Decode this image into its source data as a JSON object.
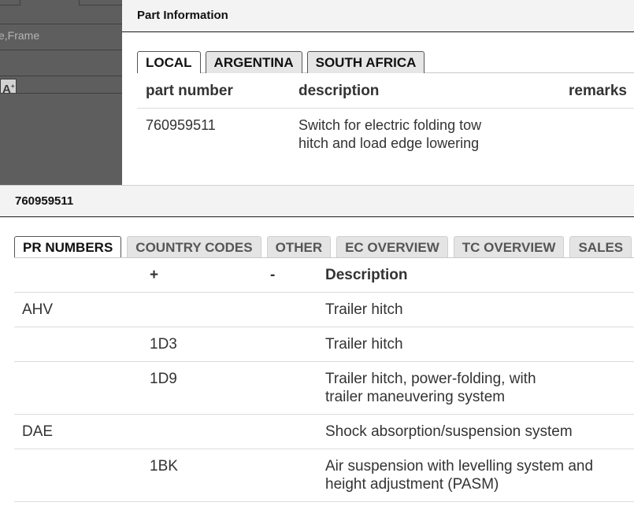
{
  "background": {
    "frame_text": "e,Frame",
    "font_icon_label": "A"
  },
  "part_info": {
    "title": "Part Information",
    "tabs": [
      {
        "label": "LOCAL",
        "active": true
      },
      {
        "label": "ARGENTINA",
        "active": false
      },
      {
        "label": "SOUTH AFRICA",
        "active": false
      }
    ],
    "columns": {
      "part_number": "part number",
      "description": "description",
      "remarks": "remarks"
    },
    "row": {
      "part_number": "760959511",
      "description": "Switch for electric folding tow hitch and load edge lowering",
      "remarks": ""
    }
  },
  "detail": {
    "title": "760959511",
    "tabs": [
      {
        "label": "PR NUMBERS",
        "active": true
      },
      {
        "label": "COUNTRY CODES",
        "active": false
      },
      {
        "label": "OTHER",
        "active": false
      },
      {
        "label": "EC OVERVIEW",
        "active": false
      },
      {
        "label": "TC OVERVIEW",
        "active": false
      },
      {
        "label": "SALES",
        "active": false
      }
    ],
    "columns": {
      "group": "",
      "plus": "+",
      "minus": "-",
      "description": "Description"
    },
    "rows": [
      {
        "group": "AHV",
        "plus": "",
        "minus": "",
        "description": "Trailer hitch"
      },
      {
        "group": "",
        "plus": "1D3",
        "minus": "",
        "description": "Trailer hitch"
      },
      {
        "group": "",
        "plus": "1D9",
        "minus": "",
        "description": "Trailer hitch, power-folding, with trailer maneuvering system"
      },
      {
        "group": "DAE",
        "plus": "",
        "minus": "",
        "description": "Shock absorption/suspension system"
      },
      {
        "group": "",
        "plus": "1BK",
        "minus": "",
        "description": "Air suspension with levelling system and height adjustment (PASM)"
      }
    ]
  }
}
